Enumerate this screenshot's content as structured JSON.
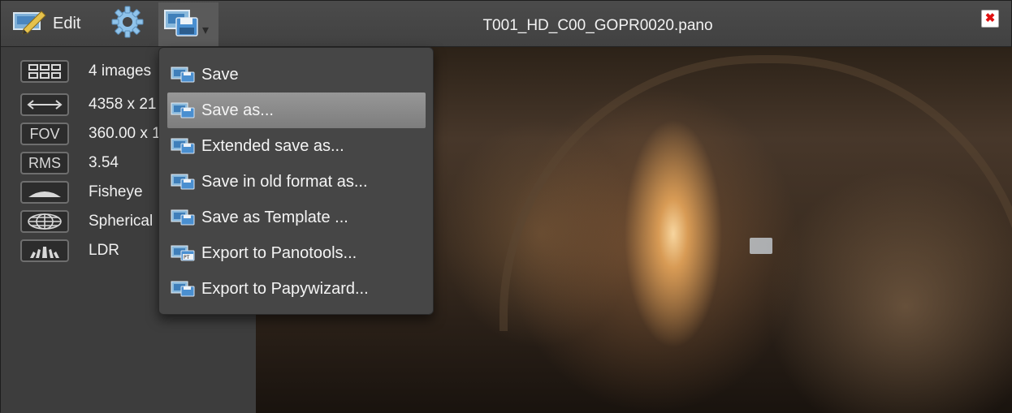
{
  "toolbar": {
    "edit_label": "Edit",
    "edit_icon": "pencil-edit-icon",
    "settings_icon": "gear-icon",
    "save_icon": "save-disk-icon",
    "dropdown_arrow": "▾"
  },
  "window": {
    "title": "T001_HD_C00_GOPR0020.pano",
    "close_icon": "close-icon",
    "close_glyph": "✖"
  },
  "info": {
    "images": {
      "icon_label": "",
      "value": "4 images"
    },
    "size": {
      "icon_label": "",
      "value": "4358 x 21"
    },
    "fov": {
      "icon_label": "FOV",
      "value": "360.00 x 1"
    },
    "rms": {
      "icon_label": "RMS",
      "value": "3.54"
    },
    "lens": {
      "icon_label": "",
      "value": "Fisheye"
    },
    "projection": {
      "icon_label": "",
      "value": "Spherical"
    },
    "range": {
      "icon_label": "",
      "value": "LDR"
    }
  },
  "menu": {
    "items": [
      {
        "label": "Save",
        "icon": "save-icon"
      },
      {
        "label": "Save as...",
        "icon": "save-icon"
      },
      {
        "label": "Extended save as...",
        "icon": "save-icon"
      },
      {
        "label": "Save in old format as...",
        "icon": "save-icon"
      },
      {
        "label": "Save as Template ...",
        "icon": "save-icon"
      },
      {
        "label": "Export to Panotools...",
        "icon": "save-pt-icon",
        "badge": "PT"
      },
      {
        "label": "Export to Papywizard...",
        "icon": "save-icon"
      }
    ],
    "selected_index": 1
  },
  "colors": {
    "menu_bg": "#464646",
    "menu_selected": "#8a8a8a",
    "toolbar_bg": "#454545",
    "close_red": "#e01010"
  }
}
